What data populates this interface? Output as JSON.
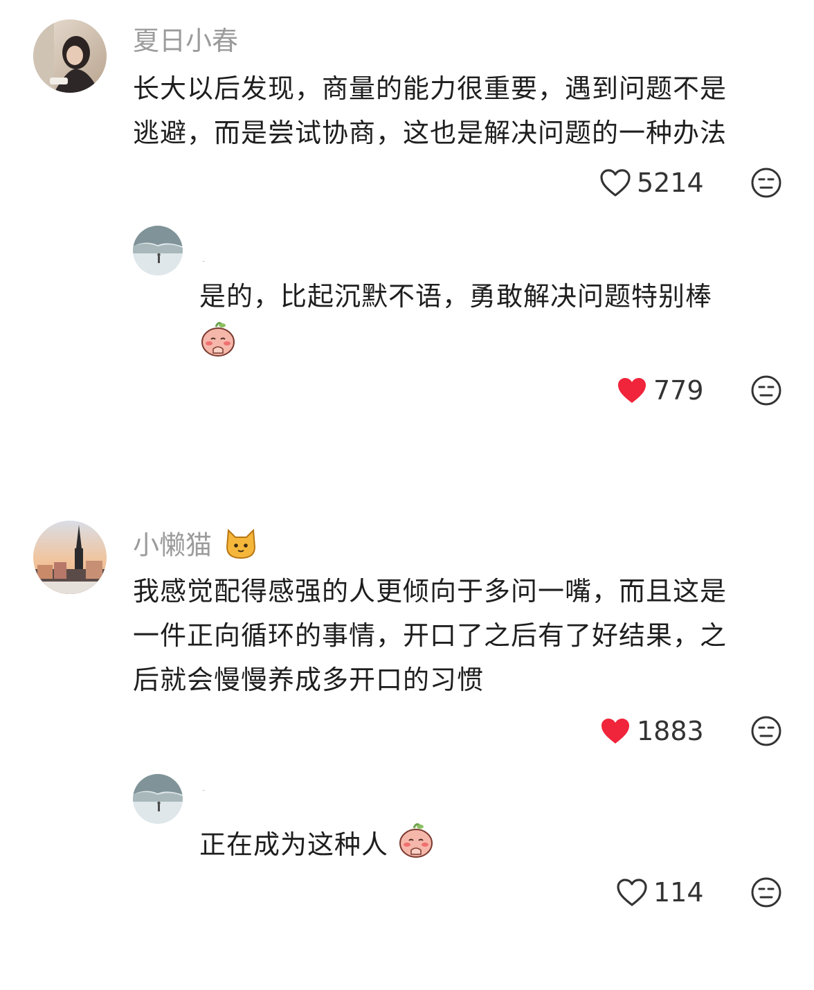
{
  "comments": [
    {
      "user": "夏日小春",
      "text_lines": [
        "长大以后发现，商量的能力很重要，遇到问题不是",
        "逃避，而是尝试协商，这也是解决问题的一种办法"
      ],
      "likes": "5214",
      "liked": false,
      "reply": {
        "user": "-",
        "text_lines": [
          "是的，比起沉默不语，勇敢解决问题特别棒"
        ],
        "likes": "779",
        "liked": true
      }
    },
    {
      "user": "小懒猫",
      "text_lines": [
        "我感觉配得感强的人更倾向于多问一嘴，而且这是",
        "一件正向循环的事情，开口了之后有了好结果，之",
        "后就会慢慢养成多开口的习惯"
      ],
      "likes": "1883",
      "liked": true,
      "reply": {
        "user": "-",
        "text": "正在成为这种人",
        "likes": "114",
        "liked": false
      }
    }
  ],
  "colors": {
    "liked_heart": "#f0243a",
    "username": "#9b9b9b",
    "text": "#1e1e1e"
  },
  "icons": {
    "like": "heart-icon",
    "dislike": "unamused-face-icon",
    "username_badge": "cat-face-emoji",
    "sticker": "peach-bow-sticker"
  }
}
